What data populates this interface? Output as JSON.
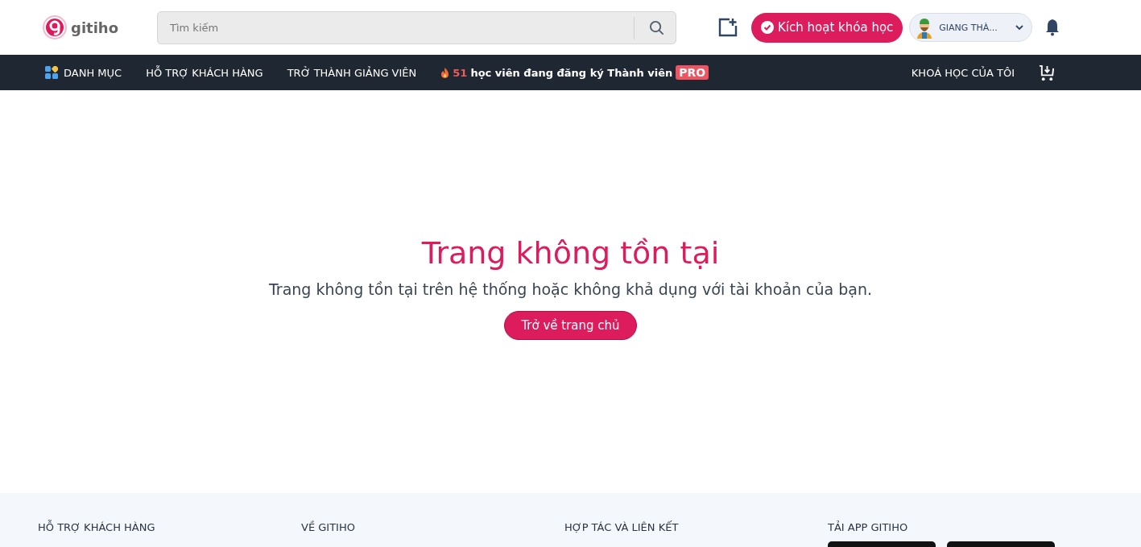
{
  "header": {
    "logo": "gitiho",
    "search": {
      "placeholder": "Tìm kiếm"
    },
    "activate_button": "Kích hoạt khóa học",
    "user": {
      "name": "GIANG THÀ..."
    }
  },
  "nav": {
    "items": [
      "DANH MỤC",
      "HỖ TRỢ KHÁCH HÀNG",
      "TRỞ THÀNH GIẢNG VIÊN"
    ],
    "promo": {
      "count": "51",
      "text": "học viên đang đăng ký Thành viên",
      "badge": "PRO"
    },
    "my_courses": "KHOÁ HỌC CỦA TÔI"
  },
  "error": {
    "title": "Trang không tồn tại",
    "message": "Trang không tồn tại trên hệ thống hoặc không khả dụng với tài khoản của bạn.",
    "button": "Trở về trang chủ"
  },
  "footer": {
    "columns": [
      "HỖ TRỢ KHÁCH HÀNG",
      "VỀ GITIHO",
      "HỢP TÁC VÀ LIÊN KẾT",
      "TẢI APP GITIHO"
    ]
  }
}
